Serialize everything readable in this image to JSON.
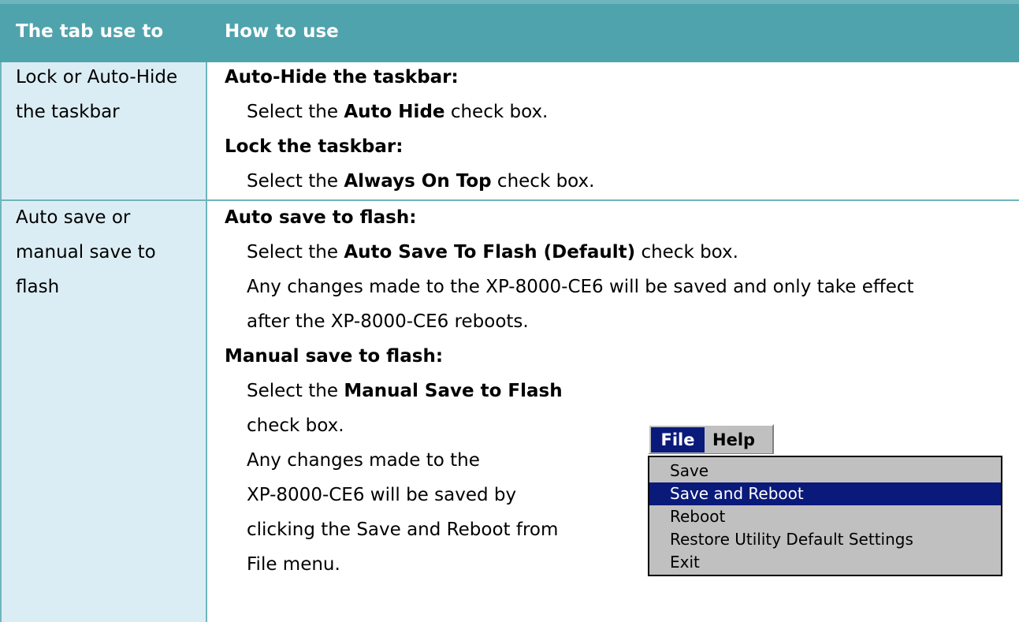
{
  "header": {
    "col1": "The tab use to",
    "col2": "How to use"
  },
  "rows": [
    {
      "tab_lines": [
        "Lock or Auto-Hide",
        "the taskbar"
      ],
      "auto_hide_heading": "Auto-Hide the taskbar:",
      "auto_hide_pre": "Select the",
      "auto_hide_bold": "Auto Hide",
      "auto_hide_post": "check box.",
      "lock_heading": "Lock the taskbar:",
      "lock_pre": "Select the",
      "lock_bold": "Always On Top",
      "lock_post": "check box."
    },
    {
      "tab_lines": [
        "Auto save or",
        "manual save to",
        "flash"
      ],
      "auto_save_heading": "Auto save to flash:",
      "auto_save_pre": "Select the",
      "auto_save_bold": "Auto Save To Flash (Default)",
      "auto_save_post": "check box.",
      "auto_save_note_1": "Any changes made to the XP-8000-CE6 will be saved and only take effect",
      "auto_save_note_2": "after the XP-8000-CE6 reboots.",
      "manual_heading": "Manual save to flash:",
      "manual_pre": "Select the",
      "manual_bold": "Manual Save to Flash",
      "manual_post": "check box.",
      "manual_note_1": "Any changes made to the",
      "manual_note_2": "XP-8000-CE6 will be saved by",
      "manual_note_3": "clicking the Save and Reboot from",
      "manual_note_4": "File menu."
    }
  ],
  "menu": {
    "bar": [
      "File",
      "Help"
    ],
    "items": [
      "Save",
      "Save and Reboot",
      "Reboot",
      "Restore Utility Default Settings",
      "Exit"
    ],
    "selected": "Save and Reboot"
  }
}
